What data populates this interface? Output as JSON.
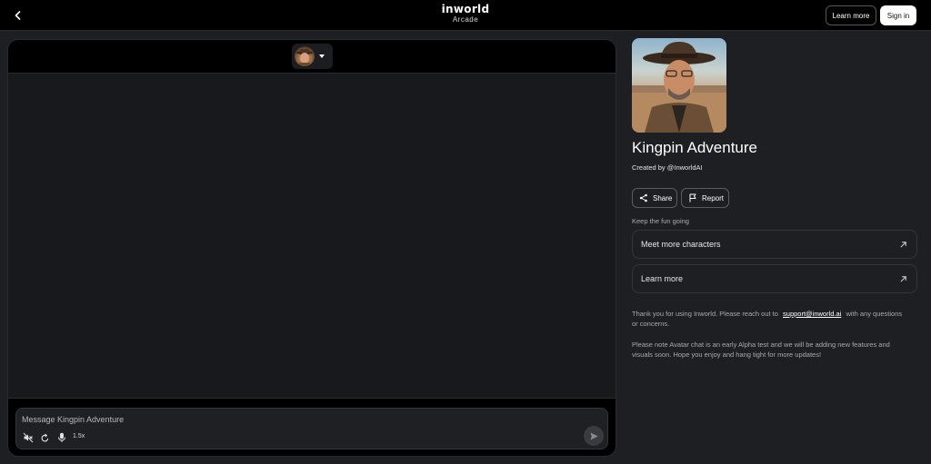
{
  "header": {
    "logo_main": "inworld",
    "logo_sub": "Arcade",
    "learn_more_label": "Learn more",
    "sign_in_label": "Sign in"
  },
  "chat": {
    "input_placeholder": "Message Kingpin Adventure",
    "speed_label": "1.5x"
  },
  "character": {
    "name": "Kingpin Adventure",
    "created_by": "Created by @InworldAI",
    "share_label": "Share",
    "report_label": "Report"
  },
  "sidebar": {
    "keep_label": "Keep the fun going",
    "links": [
      {
        "label": "Meet more characters"
      },
      {
        "label": "Learn more"
      }
    ],
    "note1_prefix": "Thank you for using Inworld. Please reach out to",
    "note1_email": "support@inworld.ai",
    "note1_suffix": "with any questions or concerns.",
    "note2": "Please note Avatar chat is an early Alpha test and we will be adding new features and visuals soon. Hope you enjoy and hang tight for more updates!"
  },
  "colors": {
    "background": "#1e1f23",
    "header": "#000000",
    "panel": "#18191c",
    "text": "#e8e8ea",
    "muted": "#a9aaae"
  },
  "icons": [
    "back-icon",
    "chevron-down-icon",
    "speaker-muted-icon",
    "refresh-icon",
    "microphone-icon",
    "send-icon",
    "share-icon",
    "flag-icon",
    "arrow-up-right-icon"
  ]
}
